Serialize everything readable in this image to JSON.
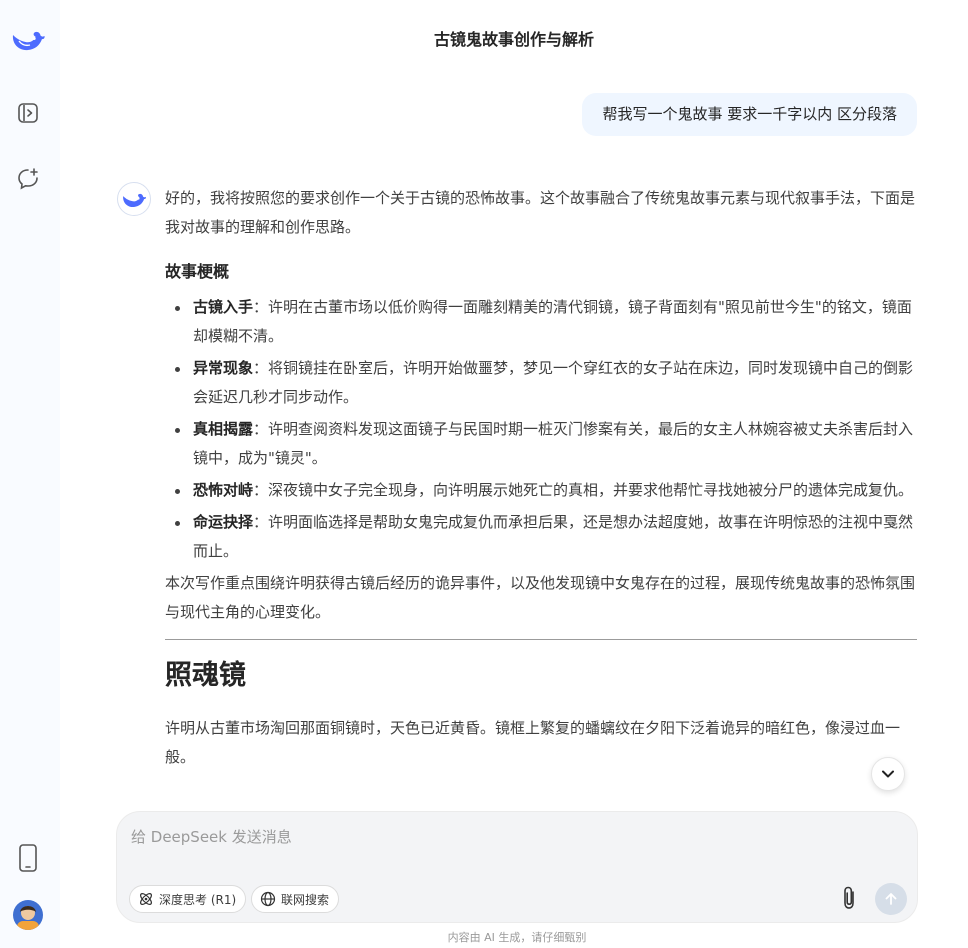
{
  "conversation": {
    "title": "古镜鬼故事创作与解析"
  },
  "user_message": "帮我写一个鬼故事 要求一千字以内 区分段落",
  "answer": {
    "intro": "好的，我将按照您的要求创作一个关于古镜的恐怖故事。这个故事融合了传统鬼故事元素与现代叙事手法，下面是我对故事的理解和创作思路。",
    "outline_heading": "故事梗概",
    "outline_items": [
      {
        "term": "古镜入手",
        "text": "：许明在古董市场以低价购得一面雕刻精美的清代铜镜，镜子背面刻有\"照见前世今生\"的铭文，镜面却模糊不清。"
      },
      {
        "term": "异常现象",
        "text": "：将铜镜挂在卧室后，许明开始做噩梦，梦见一个穿红衣的女子站在床边，同时发现镜中自己的倒影会延迟几秒才同步动作。"
      },
      {
        "term": "真相揭露",
        "text": "：许明查阅资料发现这面镜子与民国时期一桩灭门惨案有关，最后的女主人林婉容被丈夫杀害后封入镜中，成为\"镜灵\"。"
      },
      {
        "term": "恐怖对峙",
        "text": "：深夜镜中女子完全现身，向许明展示她死亡的真相，并要求他帮忙寻找她被分尸的遗体完成复仇。"
      },
      {
        "term": "命运抉择",
        "text": "：许明面临选择是帮助女鬼完成复仇而承担后果，还是想办法超度她，故事在许明惊恐的注视中戛然而止。"
      }
    ],
    "summary": "本次写作重点围绕许明获得古镜后经历的诡异事件，以及他发现镜中女鬼存在的过程，展现传统鬼故事的恐怖氛围与现代主角的心理变化。",
    "story_title": "照魂镜",
    "story_first_paragraph": "许明从古董市场淘回那面铜镜时，天色已近黄昏。镜框上繁复的蟠螭纹在夕阳下泛着诡异的暗红色，像浸过血一般。"
  },
  "composer": {
    "placeholder": "给 DeepSeek 发送消息",
    "deep_think_label": "深度思考 (R1)",
    "web_search_label": "联网搜索"
  },
  "footer": {
    "disclaimer": "内容由 AI 生成，请仔细甄别"
  },
  "colors": {
    "brand": "#4d6bfe",
    "user_bubble": "#eff6ff",
    "sidebar_bg": "#f9fbff",
    "send_disabled": "#d6dee8"
  }
}
